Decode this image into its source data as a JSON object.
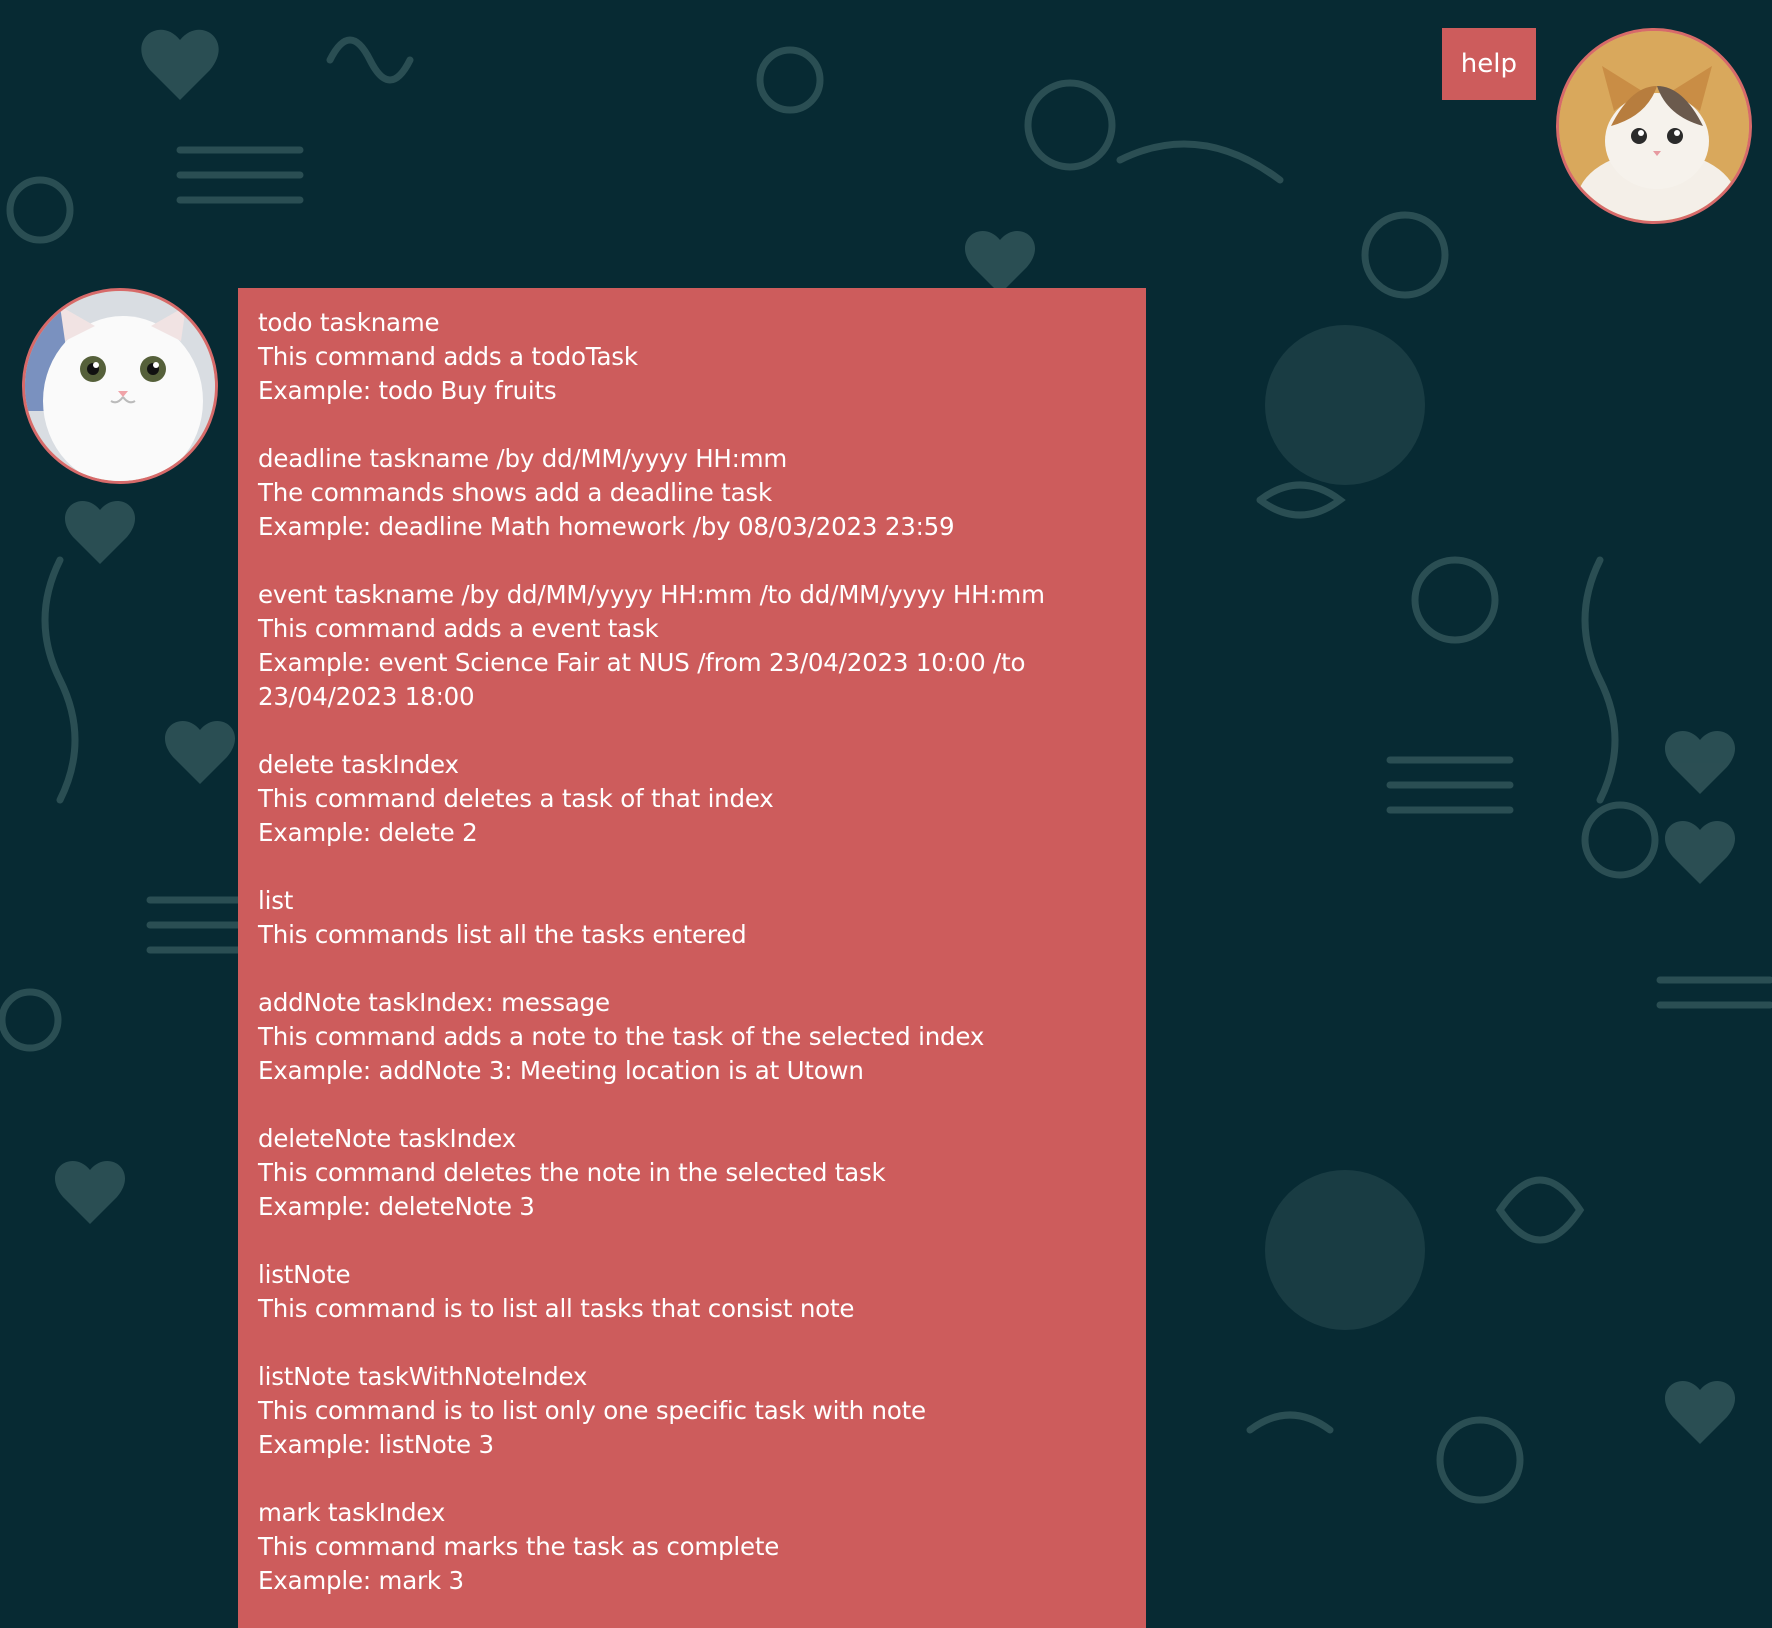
{
  "user_message": {
    "text": "help"
  },
  "bot_message": {
    "text": "todo taskname\nThis command adds a todoTask\nExample: todo Buy fruits\n\ndeadline taskname /by dd/MM/yyyy HH:mm\nThe commands shows add a deadline task\nExample: deadline Math homework /by 08/03/2023 23:59\n\nevent taskname /by dd/MM/yyyy HH:mm /to dd/MM/yyyy HH:mm\nThis command adds a event task\nExample: event Science Fair at NUS /from 23/04/2023 10:00 /to 23/04/2023 18:00\n\ndelete taskIndex\nThis command deletes a task of that index\nExample: delete 2\n\nlist\nThis commands list all the tasks entered\n\naddNote taskIndex: message\nThis command adds a note to the task of the selected index\nExample: addNote 3: Meeting location is at Utown\n\ndeleteNote taskIndex\nThis command deletes the note in the selected task\nExample: deleteNote 3\n\nlistNote\nThis command is to list all tasks that consist note\n\nlistNote taskWithNoteIndex\nThis command is to list only one specific task with note\nExample: listNote 3\n\nmark taskIndex\nThis command marks the task as complete\nExample: mark 3"
  },
  "colors": {
    "background": "#072a33",
    "pattern": "#2f4f4f",
    "bubble": "#cd5c5c",
    "avatar_border": "#d76a6a",
    "text": "#ffffff"
  },
  "icons": {
    "user_avatar": "tabby-cat-avatar-icon",
    "bot_avatar": "white-cat-avatar-icon"
  }
}
